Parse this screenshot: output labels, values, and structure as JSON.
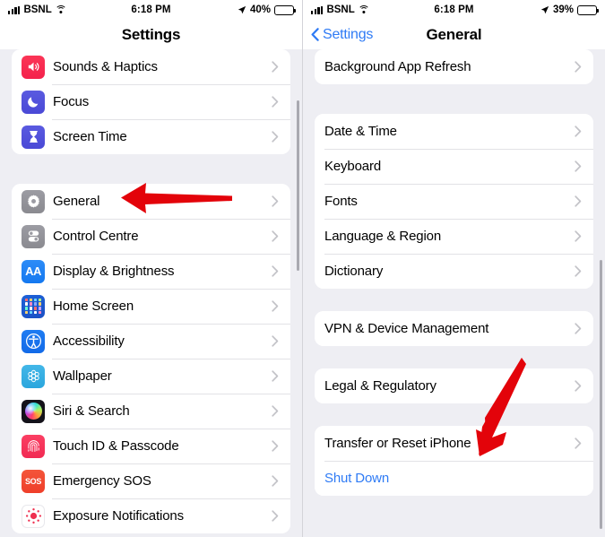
{
  "colors": {
    "accent_blue": "#2f7bf5",
    "arrow_red": "#e3030a",
    "page_bg": "#eeeef3",
    "card_bg": "#ffffff",
    "separator": "#e2e2e6",
    "chevron_gray": "#c2c2c7"
  },
  "left_screen": {
    "status_bar": {
      "signal_icon": "cellular-bars-icon",
      "carrier": "BSNL",
      "wifi_icon": "wifi-icon",
      "time": "6:18 PM",
      "location_icon": "location-arrow-icon",
      "battery_percent": "40%",
      "battery_level": 40,
      "battery_icon": "battery-icon"
    },
    "nav": {
      "title": "Settings"
    },
    "groups": [
      {
        "name": "group-sounds",
        "rows": [
          {
            "label": "Sounds & Haptics",
            "icon": "speaker-icon",
            "icon_class": "i-sounds",
            "chevron": true
          },
          {
            "label": "Focus",
            "icon": "moon-icon",
            "icon_class": "i-focus",
            "chevron": true
          },
          {
            "label": "Screen Time",
            "icon": "hourglass-icon",
            "icon_class": "i-screen",
            "chevron": true
          }
        ]
      },
      {
        "name": "group-general",
        "rows": [
          {
            "label": "General",
            "icon": "gear-icon",
            "icon_class": "i-general",
            "chevron": true
          },
          {
            "label": "Control Centre",
            "icon": "toggles-icon",
            "icon_class": "i-control",
            "chevron": true
          },
          {
            "label": "Display & Brightness",
            "icon": "aa-text-icon",
            "icon_class": "i-display",
            "chevron": true
          },
          {
            "label": "Home Screen",
            "icon": "app-grid-icon",
            "icon_class": "i-home",
            "chevron": true
          },
          {
            "label": "Accessibility",
            "icon": "accessibility-icon",
            "icon_class": "i-access",
            "chevron": true
          },
          {
            "label": "Wallpaper",
            "icon": "flower-icon",
            "icon_class": "i-wall",
            "chevron": true
          },
          {
            "label": "Siri & Search",
            "icon": "siri-orb-icon",
            "icon_class": "i-siri",
            "chevron": true
          },
          {
            "label": "Touch ID & Passcode",
            "icon": "fingerprint-icon",
            "icon_class": "i-touch",
            "chevron": true
          },
          {
            "label": "Emergency SOS",
            "icon": "sos-icon",
            "icon_class": "i-sos",
            "chevron": true
          },
          {
            "label": "Exposure Notifications",
            "icon": "exposure-dots-icon",
            "icon_class": "i-expo",
            "chevron": true
          }
        ]
      }
    ],
    "annotation": {
      "arrow": "red-arrow-pointing-left-at-general"
    }
  },
  "right_screen": {
    "status_bar": {
      "signal_icon": "cellular-bars-icon",
      "carrier": "BSNL",
      "wifi_icon": "wifi-icon",
      "time": "6:18 PM",
      "location_icon": "location-arrow-icon",
      "battery_percent": "39%",
      "battery_level": 39,
      "battery_icon": "battery-icon"
    },
    "nav": {
      "back_label": "Settings",
      "title": "General"
    },
    "groups": [
      {
        "name": "group-background",
        "rows": [
          {
            "label": "Background App Refresh",
            "chevron": true
          }
        ]
      },
      {
        "name": "group-datetime",
        "rows": [
          {
            "label": "Date & Time",
            "chevron": true
          },
          {
            "label": "Keyboard",
            "chevron": true
          },
          {
            "label": "Fonts",
            "chevron": true
          },
          {
            "label": "Language & Region",
            "chevron": true
          },
          {
            "label": "Dictionary",
            "chevron": true
          }
        ]
      },
      {
        "name": "group-vpn",
        "rows": [
          {
            "label": "VPN & Device Management",
            "chevron": true
          }
        ]
      },
      {
        "name": "group-legal",
        "rows": [
          {
            "label": "Legal & Regulatory",
            "chevron": true
          }
        ]
      },
      {
        "name": "group-reset",
        "rows": [
          {
            "label": "Transfer or Reset iPhone",
            "chevron": true
          },
          {
            "label": "Shut Down",
            "chevron": false,
            "link": true
          }
        ]
      }
    ],
    "annotation": {
      "arrow": "red-arrow-pointing-down-left-at-transfer-or-reset"
    }
  }
}
